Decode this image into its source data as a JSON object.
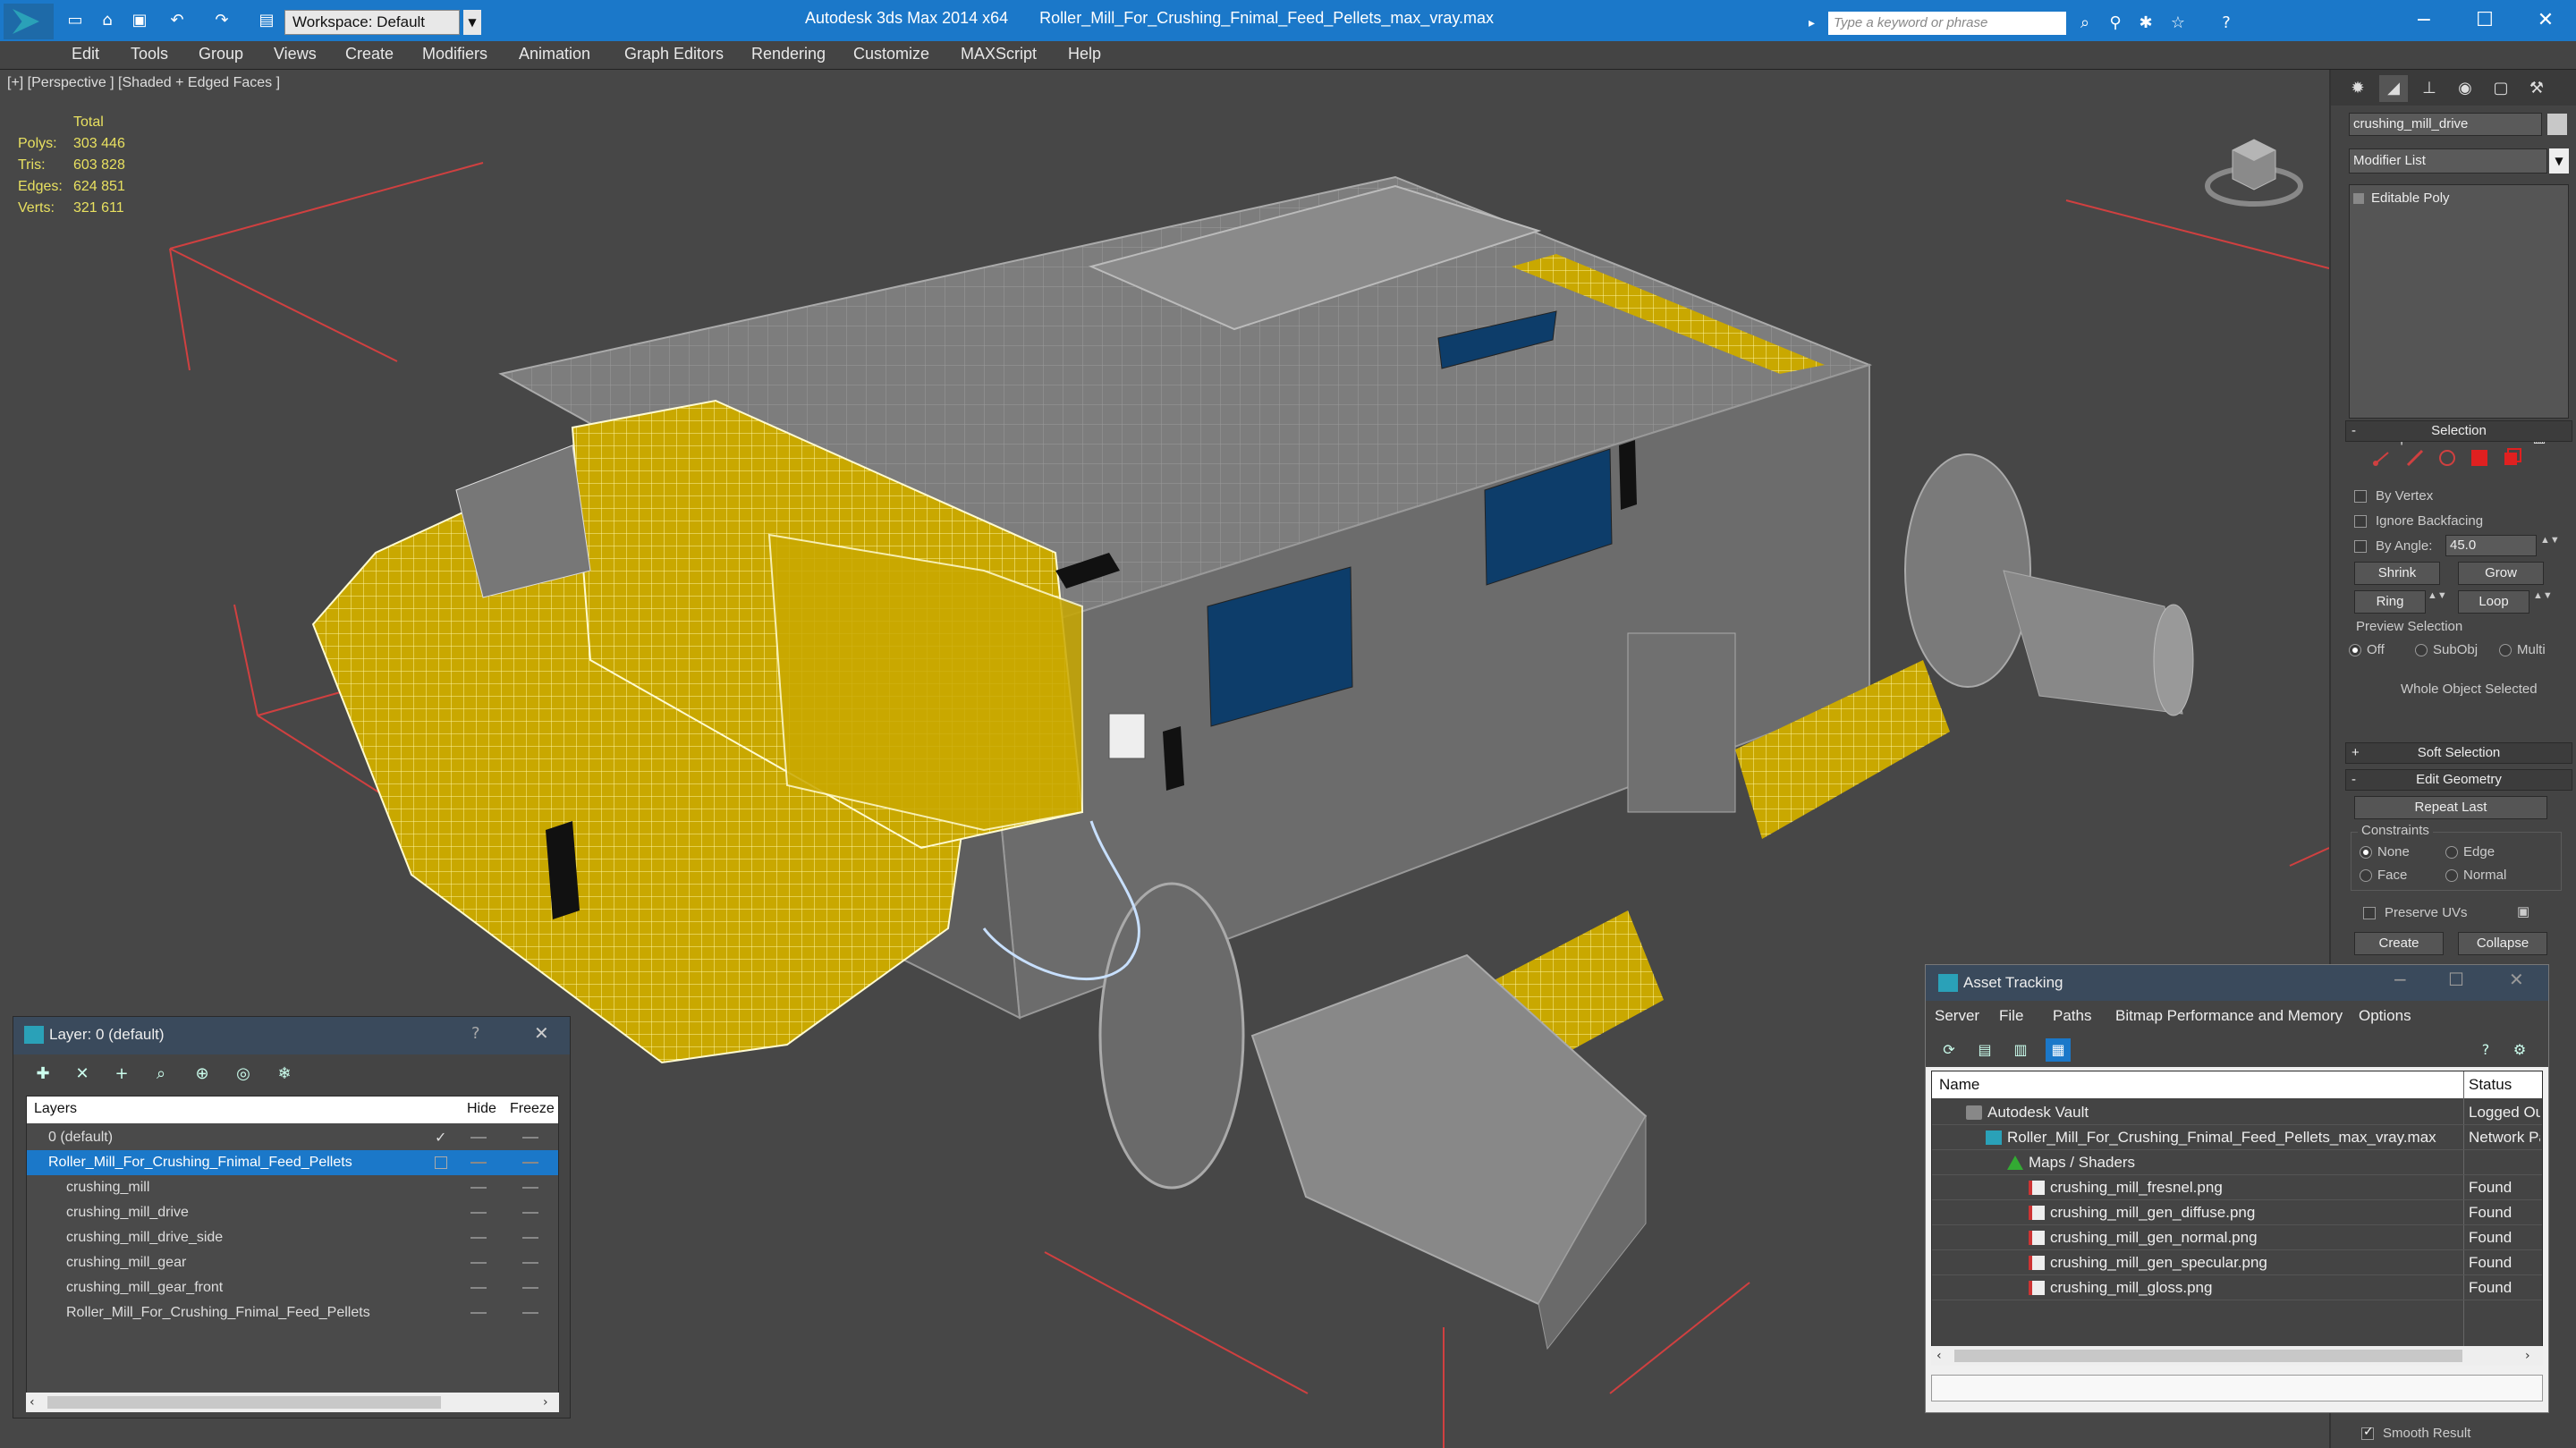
{
  "title_bar": {
    "workspace": "Workspace: Default",
    "app_name": "Autodesk 3ds Max  2014 x64",
    "file_name": "Roller_Mill_For_Crushing_Fnimal_Feed_Pellets_max_vray.max",
    "search_placeholder": "Type a keyword or phrase"
  },
  "menu": [
    "Edit",
    "Tools",
    "Group",
    "Views",
    "Create",
    "Modifiers",
    "Animation",
    "Graph Editors",
    "Rendering",
    "Customize",
    "MAXScript",
    "Help"
  ],
  "viewport": {
    "label": "[+] [Perspective ] [Shaded + Edged Faces ]",
    "stats": {
      "header": "Total",
      "rows": [
        {
          "key": "Polys:",
          "value": "303 446"
        },
        {
          "key": "Tris:",
          "value": "603 828"
        },
        {
          "key": "Edges:",
          "value": "624 851"
        },
        {
          "key": "Verts:",
          "value": "321 611"
        }
      ]
    }
  },
  "command_panel": {
    "object_name": "crushing_mill_drive",
    "modifier_list": "Modifier List",
    "stack_item": "Editable Poly",
    "selection": {
      "title": "Selection",
      "by_vertex": "By Vertex",
      "ignore_backfacing": "Ignore Backfacing",
      "by_angle": "By Angle:",
      "angle_value": "45.0",
      "shrink": "Shrink",
      "grow": "Grow",
      "ring": "Ring",
      "loop": "Loop",
      "preview_selection": "Preview Selection",
      "preview_off": "Off",
      "preview_subobj": "SubObj",
      "preview_multi": "Multi",
      "status": "Whole Object Selected"
    },
    "soft_selection": "Soft Selection",
    "edit_geometry": {
      "title": "Edit Geometry",
      "repeat_last": "Repeat Last",
      "constraints": "Constraints",
      "none": "None",
      "edge": "Edge",
      "face": "Face",
      "normal": "Normal",
      "preserve_uvs": "Preserve UVs",
      "create": "Create",
      "collapse": "Collapse"
    },
    "smooth_result": "Smooth Result"
  },
  "layer_window": {
    "title": "Layer: 0 (default)",
    "help": "?",
    "columns": {
      "layers": "Layers",
      "hide": "Hide",
      "freeze": "Freeze"
    },
    "rows": [
      {
        "name": "0 (default)",
        "indent": 1,
        "selected": false
      },
      {
        "name": "Roller_Mill_For_Crushing_Fnimal_Feed_Pellets",
        "indent": 1,
        "selected": true
      },
      {
        "name": "crushing_mill",
        "indent": 2,
        "selected": false
      },
      {
        "name": "crushing_mill_drive",
        "indent": 2,
        "selected": false
      },
      {
        "name": "crushing_mill_drive_side",
        "indent": 2,
        "selected": false
      },
      {
        "name": "crushing_mill_gear",
        "indent": 2,
        "selected": false
      },
      {
        "name": "crushing_mill_gear_front",
        "indent": 2,
        "selected": false
      },
      {
        "name": "Roller_Mill_For_Crushing_Fnimal_Feed_Pellets",
        "indent": 2,
        "selected": false
      }
    ]
  },
  "asset_window": {
    "title": "Asset Tracking",
    "menu": [
      "Server",
      "File",
      "Paths",
      "Bitmap Performance and Memory",
      "Options"
    ],
    "columns": {
      "name": "Name",
      "status": "Status"
    },
    "rows": [
      {
        "name": "Autodesk Vault",
        "status": "Logged Out",
        "indent": 1,
        "icon": "vault-icon"
      },
      {
        "name": "Roller_Mill_For_Crushing_Fnimal_Feed_Pellets_max_vray.max",
        "status": "Network Path",
        "indent": 2,
        "icon": "max-file-icon"
      },
      {
        "name": "Maps / Shaders",
        "status": "",
        "indent": 3,
        "icon": "maps-icon"
      },
      {
        "name": "crushing_mill_fresnel.png",
        "status": "Found",
        "indent": 4,
        "icon": "png-icon"
      },
      {
        "name": "crushing_mill_gen_diffuse.png",
        "status": "Found",
        "indent": 4,
        "icon": "png-icon"
      },
      {
        "name": "crushing_mill_gen_normal.png",
        "status": "Found",
        "indent": 4,
        "icon": "png-icon"
      },
      {
        "name": "crushing_mill_gen_specular.png",
        "status": "Found",
        "indent": 4,
        "icon": "png-icon"
      },
      {
        "name": "crushing_mill_gloss.png",
        "status": "Found",
        "indent": 4,
        "icon": "png-icon"
      }
    ]
  },
  "colors": {
    "accent": "#1b78c9",
    "viewport_bg": "#474747",
    "selected_wire": "#e8c000",
    "panel_bg": "#444444",
    "stats_text": "#e8e060"
  }
}
